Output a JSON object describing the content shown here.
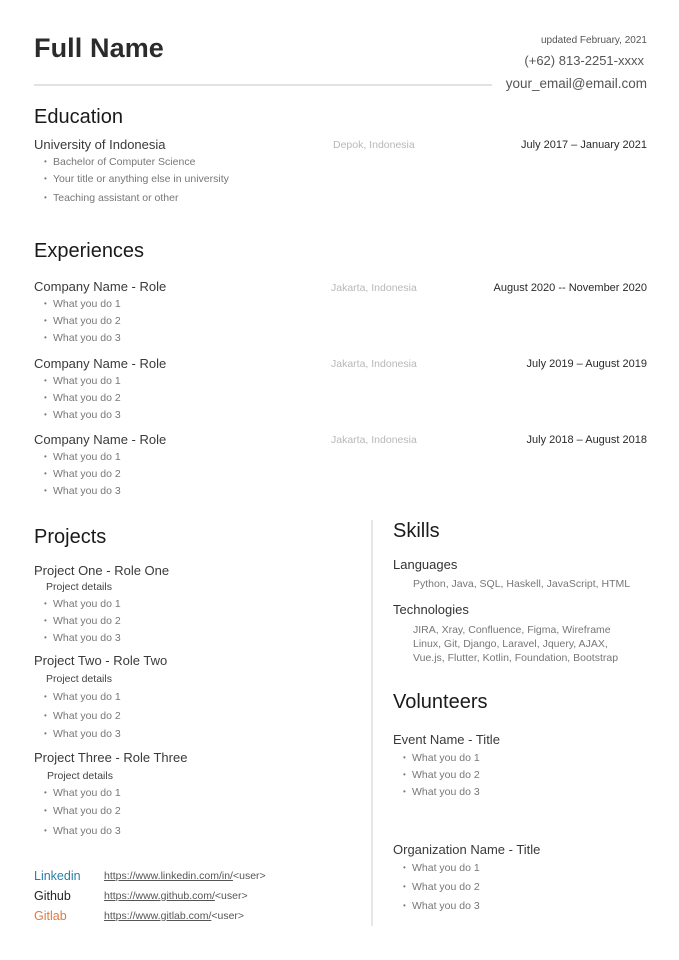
{
  "header": {
    "name": "Full Name",
    "updated": "updated February, 2021",
    "phone": "(+62) 813-2251-xxxx",
    "email": "your_email@email.com"
  },
  "education": {
    "title": "Education",
    "entries": [
      {
        "school": "University of Indonesia",
        "location": "Depok, Indonesia",
        "date": "July 2017 – January 2021",
        "bullets": [
          "Bachelor of Computer Science",
          "Your title or anything else in university",
          "Teaching assistant or other"
        ]
      }
    ]
  },
  "experiences": {
    "title": "Experiences",
    "entries": [
      {
        "title": "Company Name  -  Role",
        "location": "Jakarta, Indonesia",
        "date": "August 2020 -- November 2020",
        "bullets": [
          "What you do 1",
          "What you do 2",
          "What you do 3"
        ]
      },
      {
        "title": "Company Name  -  Role",
        "location": "Jakarta, Indonesia",
        "date": "July 2019 – August 2019",
        "bullets": [
          "What you do 1",
          "What you do 2",
          "What you do 3"
        ]
      },
      {
        "title": "Company Name  -  Role",
        "location": "Jakarta, Indonesia",
        "date": "July 2018 – August 2018",
        "bullets": [
          "What you do 1",
          "What you do 2",
          "What you do 3"
        ]
      }
    ]
  },
  "projects": {
    "title": "Projects",
    "entries": [
      {
        "title": "Project One -  Role One",
        "details": "Project details",
        "bullets": [
          "What you do 1",
          "What you do 2",
          "What you do 3"
        ]
      },
      {
        "title": "Project Two -  Role Two",
        "details": "Project details",
        "bullets": [
          "What you do 1",
          "What you do 2",
          "What you do 3"
        ]
      },
      {
        "title": "Project Three  -  Role Three",
        "details": "Project details",
        "bullets": [
          "What you do 1",
          "What you do 2",
          "What you do 3"
        ]
      }
    ]
  },
  "links": [
    {
      "label": "Linkedin",
      "color": "#2a7fa8",
      "url": "https://www.linkedin.com/in/",
      "suffix": "<user>"
    },
    {
      "label": "Github",
      "color": "#222222",
      "url": "https://www.github.com/",
      "suffix": "<user>"
    },
    {
      "label": "Gitlab",
      "color": "#e2793f",
      "url": "https://www.gitlab.com/",
      "suffix": "<user>"
    }
  ],
  "skills": {
    "title": "Skills",
    "languages_label": "Languages",
    "languages": "Python, Java, SQL, Haskell, JavaScript, HTML",
    "technologies_label": "Technologies",
    "technologies": [
      "JIRA, Xray, Confluence, Figma, Wireframe",
      "Linux, Git, Django, Laravel, Jquery, AJAX,",
      "Vue.js, Flutter, Kotlin, Foundation, Bootstrap"
    ]
  },
  "volunteers": {
    "title": "Volunteers",
    "entries": [
      {
        "title": "Event Name  -  Title",
        "bullets": [
          "What you do 1",
          "What you do 2",
          "What you do 3"
        ]
      },
      {
        "title": "Organization Name - Title",
        "bullets": [
          "What you do 1",
          "What you do 2",
          "What you do 3"
        ]
      }
    ]
  }
}
